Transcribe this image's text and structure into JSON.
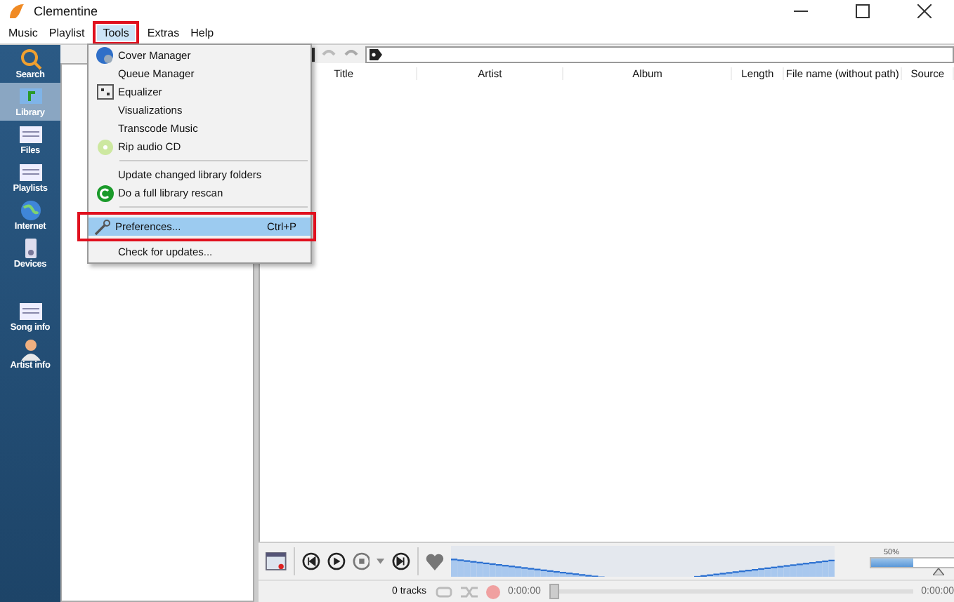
{
  "window": {
    "title": "Clementine"
  },
  "menubar": [
    {
      "label": "Music",
      "selected": false
    },
    {
      "label": "Playlist",
      "selected": false
    },
    {
      "label": "Tools",
      "selected": true
    },
    {
      "label": "Extras",
      "selected": false
    },
    {
      "label": "Help",
      "selected": false
    }
  ],
  "sidebar": [
    {
      "label": "Search",
      "selected": false
    },
    {
      "label": "Library",
      "selected": true
    },
    {
      "label": "Files",
      "selected": false
    },
    {
      "label": "Playlists",
      "selected": false
    },
    {
      "label": "Internet",
      "selected": false
    },
    {
      "label": "Devices",
      "selected": false
    },
    {
      "label": "Song info",
      "selected": false
    },
    {
      "label": "Artist info",
      "selected": false
    }
  ],
  "tools_menu": [
    {
      "kind": "item",
      "label": "Cover Manager",
      "selected": false
    },
    {
      "kind": "item",
      "label": "Queue Manager",
      "selected": false
    },
    {
      "kind": "item",
      "label": "Equalizer",
      "selected": false
    },
    {
      "kind": "item",
      "label": "Visualizations",
      "selected": false
    },
    {
      "kind": "item",
      "label": "Transcode Music",
      "selected": false
    },
    {
      "kind": "item",
      "label": "Rip audio CD",
      "selected": false
    },
    {
      "kind": "separator"
    },
    {
      "kind": "item",
      "label": "Update changed library folders",
      "selected": false
    },
    {
      "kind": "item",
      "label": "Do a full library rescan",
      "selected": false
    },
    {
      "kind": "separator"
    },
    {
      "kind": "item",
      "label": "Preferences...",
      "shortcut": "Ctrl+P",
      "selected": true
    },
    {
      "kind": "item",
      "label": "Check for updates...",
      "selected": false
    }
  ],
  "playlist": {
    "columns": [
      "Title",
      "Artist",
      "Album",
      "Length",
      "File name (without path)",
      "Source"
    ]
  },
  "volume": {
    "reading": "50%",
    "level": 0.5
  },
  "status_bar": {
    "tracks": "0 tracks",
    "elapsed": "0:00:00",
    "total": "0:00:00",
    "seek": {
      "level": 0
    }
  }
}
